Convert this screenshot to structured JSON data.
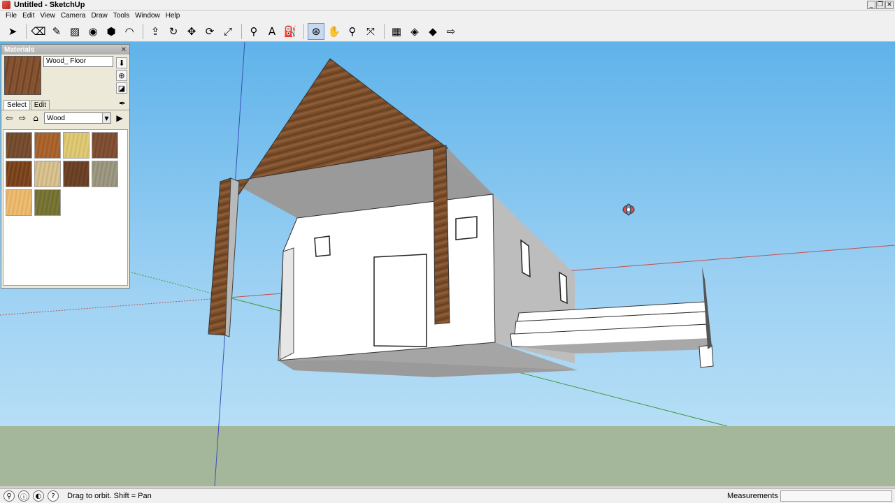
{
  "window": {
    "title": "Untitled - SketchUp",
    "buttons": [
      "_",
      "❐",
      "✕"
    ]
  },
  "menu": [
    "File",
    "Edit",
    "View",
    "Camera",
    "Draw",
    "Tools",
    "Window",
    "Help"
  ],
  "toolbar": {
    "tools": [
      {
        "name": "select-tool",
        "glyph": "➤"
      },
      {
        "name": "eraser-tool",
        "glyph": "⌫"
      },
      {
        "name": "line-tool",
        "glyph": "✎"
      },
      {
        "name": "rectangle-tool",
        "glyph": "▨"
      },
      {
        "name": "circle-tool",
        "glyph": "◉"
      },
      {
        "name": "polygon-tool",
        "glyph": "⬢"
      },
      {
        "name": "arc-tool",
        "glyph": "◠"
      },
      {
        "name": "push-pull-tool",
        "glyph": "⇪"
      },
      {
        "name": "follow-me-tool",
        "glyph": "↻"
      },
      {
        "name": "move-tool",
        "glyph": "✥"
      },
      {
        "name": "rotate-tool",
        "glyph": "⟳"
      },
      {
        "name": "scale-tool",
        "glyph": "⤢"
      },
      {
        "name": "tape-measure-tool",
        "glyph": "⚲"
      },
      {
        "name": "text-tool",
        "glyph": "A"
      },
      {
        "name": "paint-bucket-tool",
        "glyph": "⛽"
      },
      {
        "name": "orbit-tool",
        "glyph": "⊛",
        "active": true
      },
      {
        "name": "pan-tool",
        "glyph": "✋"
      },
      {
        "name": "zoom-tool",
        "glyph": "⚲"
      },
      {
        "name": "zoom-extents-tool",
        "glyph": "⤧"
      },
      {
        "name": "warehouse-tool",
        "glyph": "▦"
      },
      {
        "name": "components-tool",
        "glyph": "◈"
      },
      {
        "name": "share-model-tool",
        "glyph": "◆"
      },
      {
        "name": "send-to-layout-tool",
        "glyph": "⇨"
      }
    ]
  },
  "materials": {
    "title": "Materials",
    "close": "✕",
    "current_name": "Wood_ Floor",
    "side_buttons": [
      "⬇",
      "⊕",
      "◪"
    ],
    "tabs": [
      "Select",
      "Edit"
    ],
    "active_tab": "Select",
    "eyedropper": "✒",
    "nav": {
      "back": "⇦",
      "forward": "⇨",
      "home": "⌂",
      "details": "▶"
    },
    "collection": "Wood",
    "collection_arrow": "▼",
    "swatches": [
      {
        "name": "wood-swatch-1",
        "a": "#7e5436",
        "b": "#6b4429"
      },
      {
        "name": "wood-swatch-2",
        "a": "#b36a32",
        "b": "#9c5a28"
      },
      {
        "name": "wood-swatch-3",
        "a": "#e3cf7d",
        "b": "#d2bb66"
      },
      {
        "name": "wood-swatch-4",
        "a": "#88563a",
        "b": "#74462c"
      },
      {
        "name": "wood-swatch-5",
        "a": "#8a4e22",
        "b": "#6a3a18"
      },
      {
        "name": "wood-swatch-6",
        "a": "#e0c99a",
        "b": "#c9b07e"
      },
      {
        "name": "wood-swatch-7",
        "a": "#75472a",
        "b": "#603a22"
      },
      {
        "name": "wood-swatch-8",
        "a": "#a39f88",
        "b": "#8f8a74"
      },
      {
        "name": "wood-swatch-9",
        "a": "#f0c27a",
        "b": "#e2ac5e"
      },
      {
        "name": "wood-swatch-10",
        "a": "#7f7c3a",
        "b": "#6c6a2c"
      }
    ]
  },
  "status": {
    "icons": [
      "⚲",
      "ⓘ",
      "◐",
      "?"
    ],
    "hint": "Drag to orbit.  Shift = Pan",
    "measurements_label": "Measurements"
  },
  "colors": {
    "sky": "#7cc3f0",
    "ground": "#a5b79a",
    "roof_wood": "#7a4d2b",
    "wall": "#ffffff",
    "shadow_gray": "#a8a8a8",
    "axis_red": "#c25050",
    "axis_green": "#3f9a3f",
    "axis_blue": "#3a4fb8"
  }
}
